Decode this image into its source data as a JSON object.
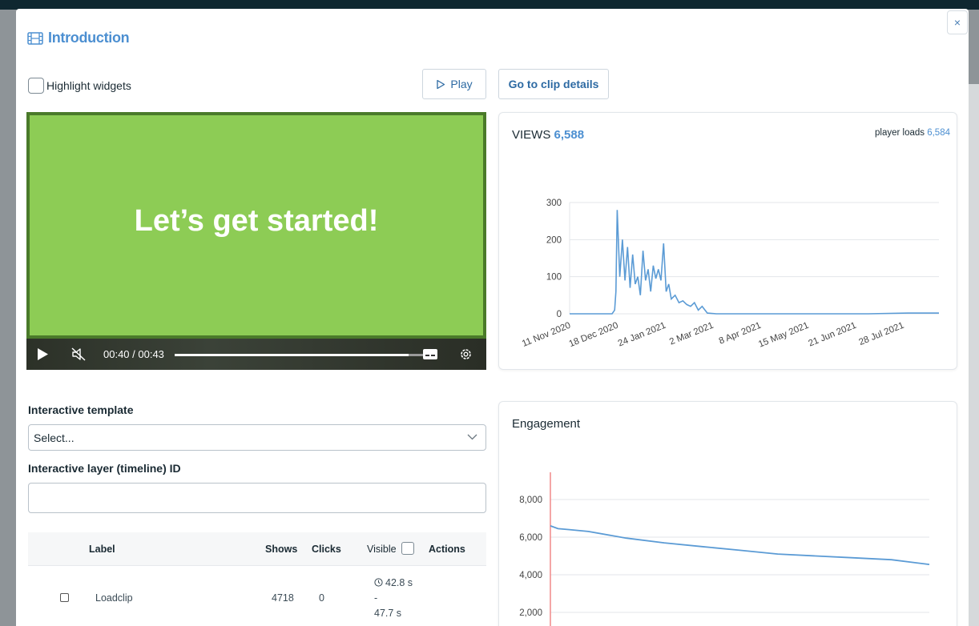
{
  "modal": {
    "title": "Introduction",
    "close_label": "×"
  },
  "controls": {
    "highlight_label": "Highlight widgets",
    "play_label": "Play",
    "clip_details_label": "Go to clip details"
  },
  "video": {
    "slide_text": "Let’s get started!",
    "time": "00:40 / 00:43",
    "progress": 0.93
  },
  "views": {
    "label": "VIEWS",
    "count": "6,588",
    "player_loads_label": "player loads",
    "player_loads_value": "6,584"
  },
  "form": {
    "template_label": "Interactive template",
    "template_value": "Select...",
    "layer_label": "Interactive layer (timeline) ID",
    "layer_value": ""
  },
  "table": {
    "headers": [
      "Label",
      "Shows",
      "Clicks",
      "Visible",
      "Actions"
    ],
    "rows": [
      {
        "label": "Loadclip",
        "shows": "4718",
        "clicks": "0",
        "time_start": "42.8 s",
        "dash": "-",
        "time_end": "47.7 s"
      }
    ]
  },
  "engagement": {
    "title": "Engagement"
  },
  "colors": {
    "accent": "#4c8fd1",
    "link": "#2d6aa3",
    "slide_bg": "#8dcc55",
    "slide_border": "#4a7a2a",
    "line": "#5b9bd5",
    "marker": "#f08080"
  },
  "chart_data": [
    {
      "type": "line",
      "title": "VIEWS 6,588",
      "x_ticks": [
        "11 Nov 2020",
        "18 Dec 2020",
        "24 Jan 2021",
        "2 Mar 2021",
        "8 Apr 2021",
        "15 May 2021",
        "21 Jun 2021",
        "28 Jul 2021"
      ],
      "y_ticks": [
        "0",
        "100",
        "200",
        "300"
      ],
      "ylim": [
        0,
        300
      ],
      "grid": true,
      "series": [
        {
          "x": [
            "2020-11-11",
            "2020-11-20",
            "2020-12-01",
            "2020-12-10",
            "2020-12-14",
            "2020-12-16",
            "2020-12-17",
            "2020-12-18",
            "2020-12-20",
            "2020-12-22",
            "2020-12-24",
            "2020-12-26",
            "2020-12-28",
            "2020-12-30",
            "2021-01-01",
            "2021-01-03",
            "2021-01-05",
            "2021-01-07",
            "2021-01-09",
            "2021-01-11",
            "2021-01-13",
            "2021-01-15",
            "2021-01-17",
            "2021-01-19",
            "2021-01-21",
            "2021-01-23",
            "2021-01-25",
            "2021-01-27",
            "2021-01-29",
            "2021-02-01",
            "2021-02-04",
            "2021-02-07",
            "2021-02-10",
            "2021-02-13",
            "2021-02-16",
            "2021-02-19",
            "2021-02-22",
            "2021-02-26",
            "2021-03-05",
            "2021-03-15",
            "2021-04-01",
            "2021-05-01",
            "2021-06-01",
            "2021-07-01",
            "2021-08-01",
            "2021-08-25"
          ],
          "values": [
            0,
            0,
            0,
            0,
            0,
            10,
            60,
            280,
            100,
            200,
            90,
            180,
            70,
            160,
            80,
            100,
            50,
            170,
            90,
            120,
            60,
            130,
            95,
            120,
            90,
            190,
            60,
            80,
            40,
            50,
            30,
            35,
            25,
            20,
            30,
            10,
            20,
            2,
            0,
            0,
            0,
            0,
            0,
            0,
            2,
            2
          ]
        }
      ]
    },
    {
      "type": "line",
      "title": "Engagement",
      "y_ticks": [
        "2,000",
        "4,000",
        "6,000",
        "8,000"
      ],
      "ylim": [
        1500,
        9000
      ],
      "grid": true,
      "series": [
        {
          "x": [
            0,
            2,
            5,
            10,
            20,
            30,
            40,
            50,
            60,
            70,
            80,
            90,
            100
          ],
          "values": [
            6600,
            6450,
            6400,
            6300,
            5950,
            5700,
            5500,
            5300,
            5100,
            5000,
            4900,
            4800,
            4550
          ]
        }
      ]
    }
  ]
}
